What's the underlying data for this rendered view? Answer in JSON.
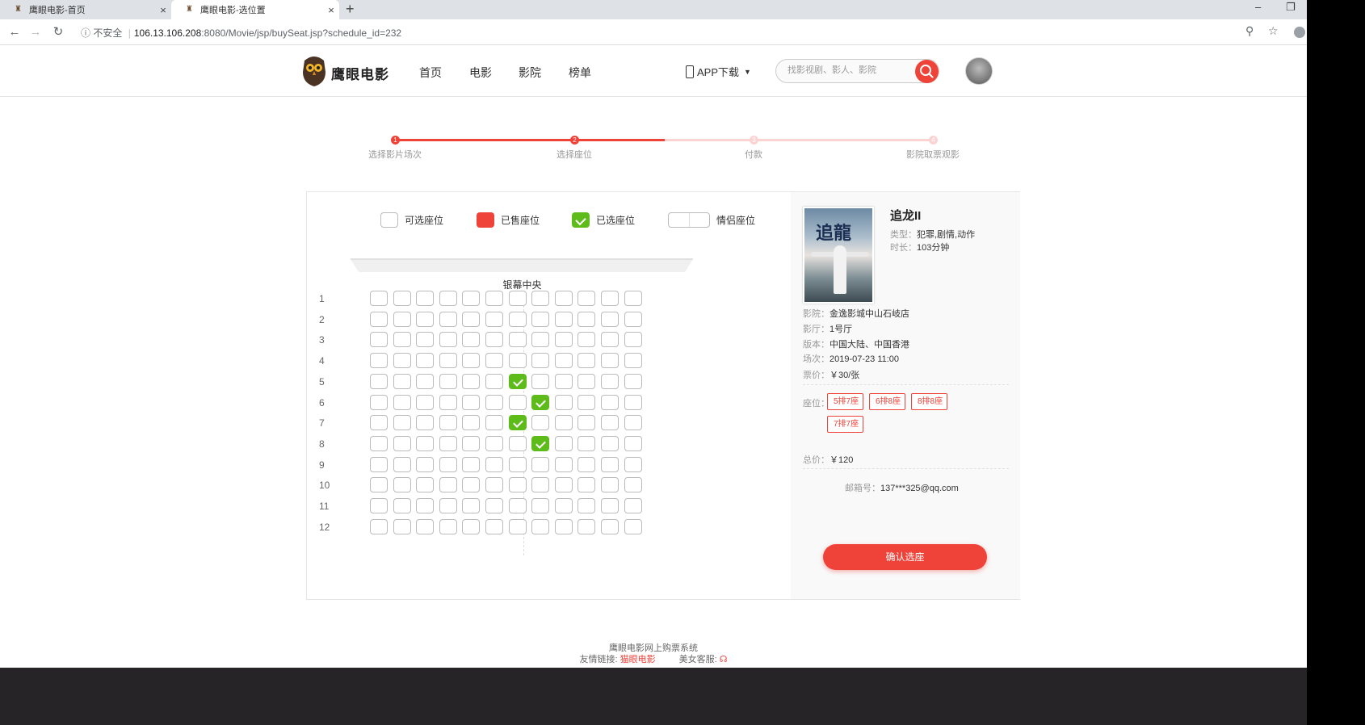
{
  "browser": {
    "tabs": [
      {
        "title": "鹰眼电影-首页",
        "close": "×"
      },
      {
        "title": "鹰眼电影-选位置",
        "close": "×"
      }
    ],
    "new_tab": "+",
    "window_controls": {
      "minimize": "–",
      "restore": "❐"
    },
    "address": {
      "security": "不安全",
      "host": "106.13.106.208",
      "path": ":8080/Movie/jsp/buySeat.jsp?schedule_id=232"
    }
  },
  "site": {
    "logo_text": "鹰眼电影",
    "nav": [
      "首页",
      "电影",
      "影院",
      "榜单"
    ],
    "app_download": "APP下载",
    "search_placeholder": "找影视剧、影人、影院"
  },
  "steps": [
    {
      "num": "1",
      "label": "选择影片场次",
      "done": true
    },
    {
      "num": "2",
      "label": "选择座位",
      "done": true
    },
    {
      "num": "3",
      "label": "付款",
      "done": false
    },
    {
      "num": "4",
      "label": "影院取票观影",
      "done": false
    }
  ],
  "legend": {
    "available": "可选座位",
    "sold": "已售座位",
    "selected": "已选座位",
    "couple": "情侣座位"
  },
  "screen_label": "银幕中央",
  "seat_map": {
    "rows": [
      "1",
      "2",
      "3",
      "4",
      "5",
      "6",
      "7",
      "8",
      "9",
      "10",
      "11",
      "12"
    ],
    "seats_per_row": 12,
    "selected": [
      [
        5,
        7
      ],
      [
        6,
        8
      ],
      [
        7,
        7
      ],
      [
        8,
        8
      ]
    ]
  },
  "movie": {
    "title": "追龙II",
    "poster_text": "追龍",
    "type_label": "类型：",
    "type": "犯罪,剧情,动作",
    "duration_label": "时长：",
    "duration": "103分钟"
  },
  "details": {
    "cinema_label": "影院：",
    "cinema": "金逸影城中山石岐店",
    "hall_label": "影厅：",
    "hall": "1号厅",
    "version_label": "版本：",
    "version": "中国大陆、中国香港",
    "session_label": "场次：",
    "session": "2019-07-23 11:00",
    "price_label": "票价：",
    "price": "￥30/张"
  },
  "seats_label": "座位：",
  "selected_seats": [
    "5排7座",
    "6排8座",
    "8排8座",
    "7排7座"
  ],
  "total_label": "总价：",
  "total": "￥120",
  "email_label": "邮箱号：",
  "email": "137***325@qq.com",
  "confirm_button": "确认选座",
  "footer": {
    "line1": "鹰眼电影网上购票系统",
    "links_label": "友情链接:",
    "link_brand": "猫眼电影",
    "service_label": "美女客服:"
  },
  "colors": {
    "accent": "#ef4238",
    "selected": "#5dbb1a",
    "footer_bg": "#262426"
  }
}
